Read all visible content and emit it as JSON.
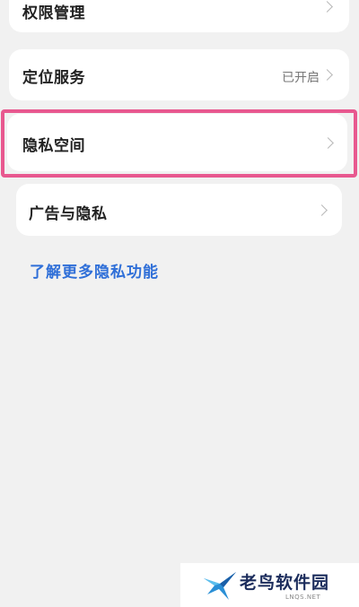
{
  "settings": {
    "items": [
      {
        "label": "权限管理",
        "value": ""
      },
      {
        "label": "定位服务",
        "value": "已开启"
      },
      {
        "label": "隐私空间",
        "value": ""
      },
      {
        "label": "广告与隐私",
        "value": ""
      }
    ],
    "more_link": "了解更多隐私功能"
  },
  "watermark": {
    "name": "老鸟软件园",
    "url": "LNQS.NET"
  },
  "colors": {
    "background": "#f1f1f1",
    "card": "#ffffff",
    "highlight": "#e8588f",
    "link": "#2f6fd8"
  }
}
